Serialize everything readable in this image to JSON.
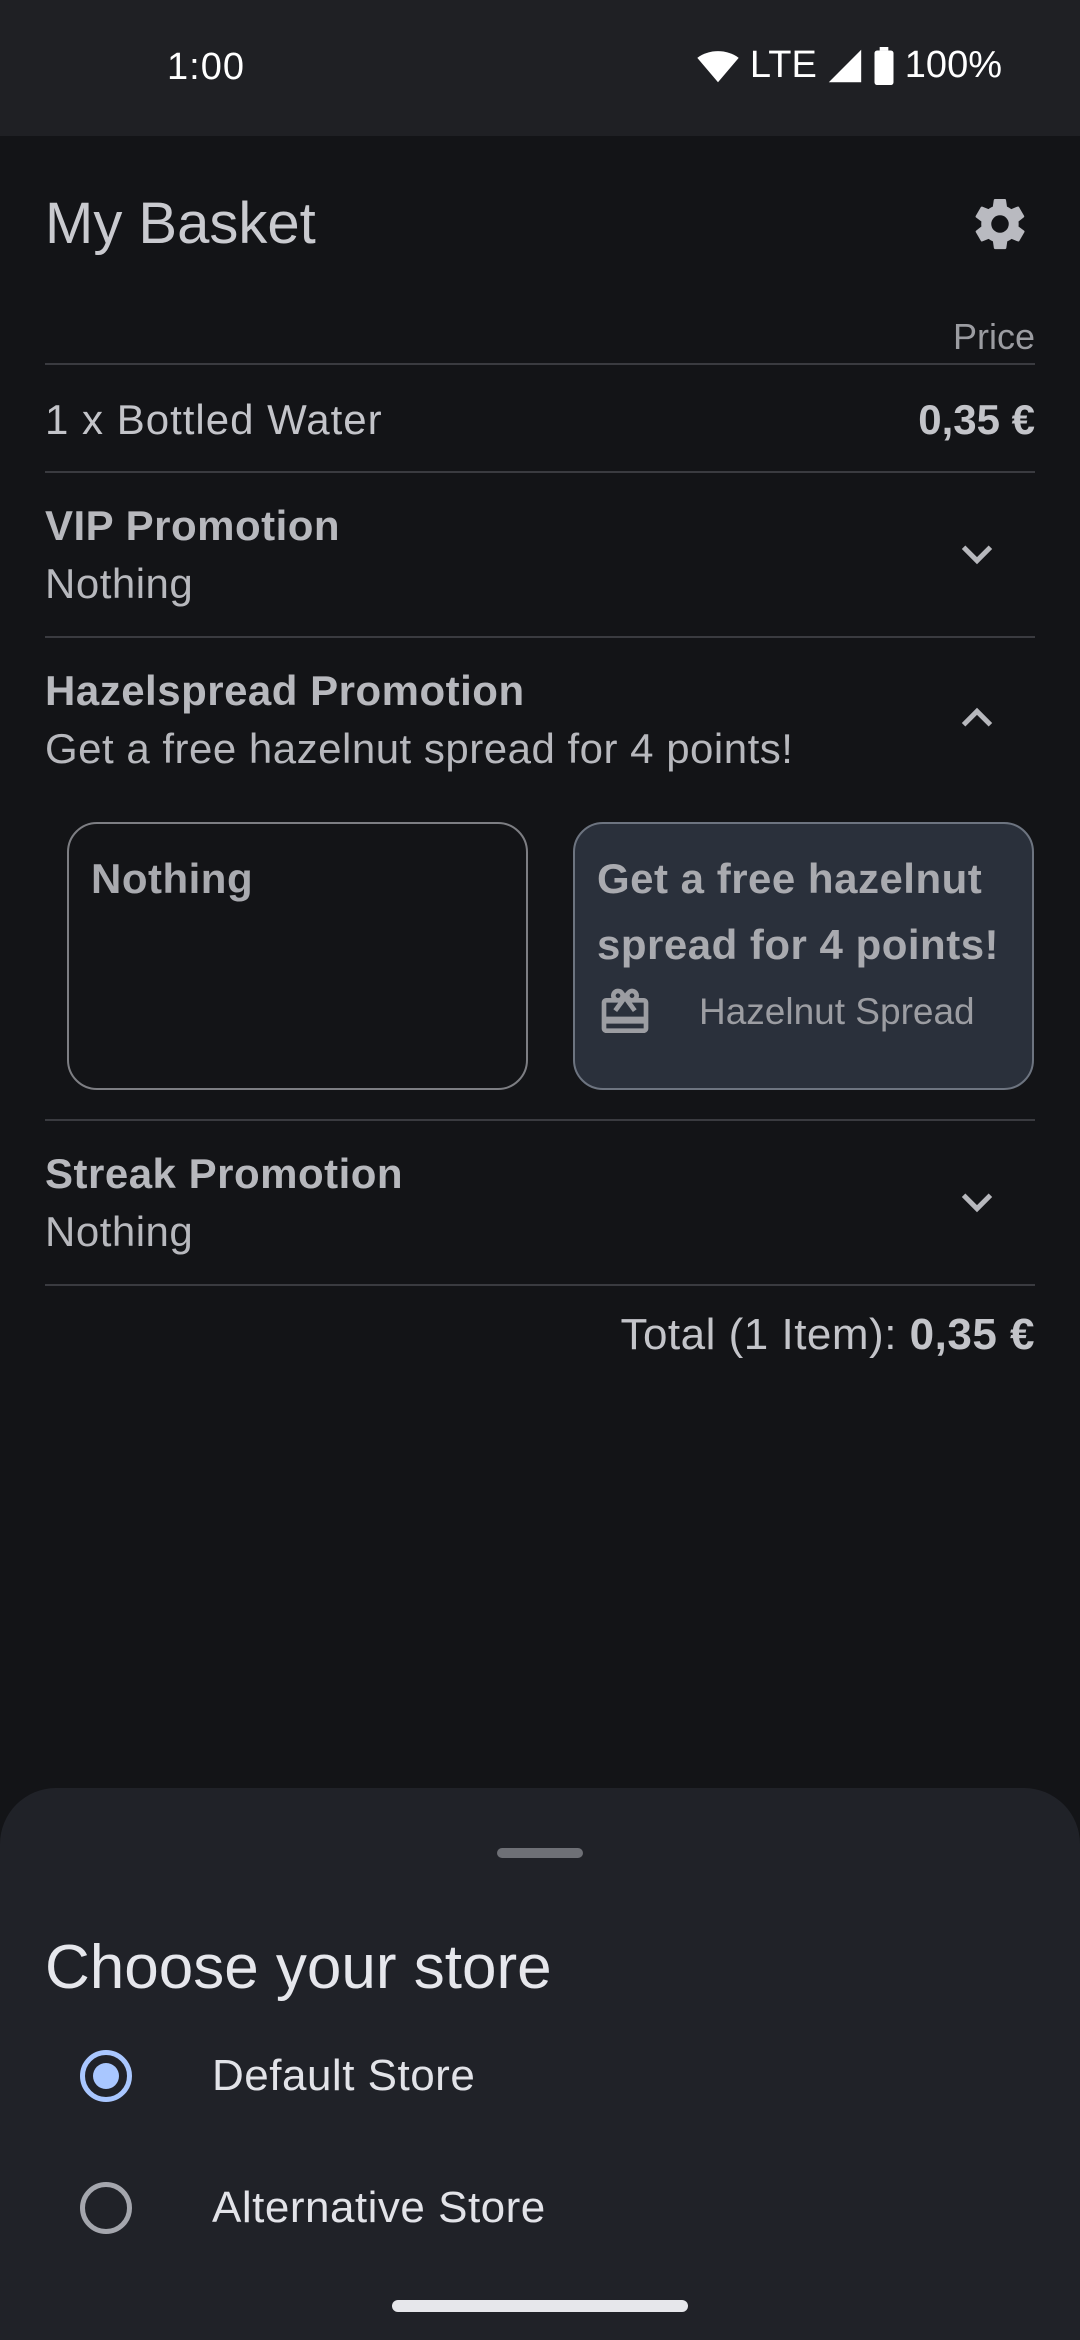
{
  "status_bar": {
    "time": "1:00",
    "network": "LTE",
    "battery": "100%",
    "icons": [
      "wifi-icon",
      "signal-icon",
      "battery-icon"
    ]
  },
  "header": {
    "title": "My Basket",
    "settings_icon": "gear-icon"
  },
  "basket": {
    "price_column_label": "Price",
    "items": [
      {
        "label": "1 x Bottled Water",
        "price": "0,35 €"
      }
    ],
    "promotions": [
      {
        "title": "VIP Promotion",
        "selection": "Nothing",
        "expanded": false
      },
      {
        "title": "Hazelspread Promotion",
        "selection": "Get a free hazelnut spread for 4 points!",
        "expanded": true,
        "options": [
          {
            "title": "Nothing",
            "selected": false
          },
          {
            "title": "Get a free hazelnut spread for 4 points!",
            "reward": "Hazelnut Spread",
            "reward_icon": "gift-icon",
            "selected": true
          }
        ]
      },
      {
        "title": "Streak Promotion",
        "selection": "Nothing",
        "expanded": false
      }
    ],
    "total_label": "Total (1 Item):",
    "total_value": "0,35 €"
  },
  "store_sheet": {
    "title": "Choose your store",
    "options": [
      {
        "label": "Default Store",
        "selected": true
      },
      {
        "label": "Alternative Store",
        "selected": false
      }
    ]
  },
  "colors": {
    "background": "#131417",
    "sheet": "#202228",
    "selected_card": "#2a303b",
    "accent": "#a9c7ff"
  }
}
